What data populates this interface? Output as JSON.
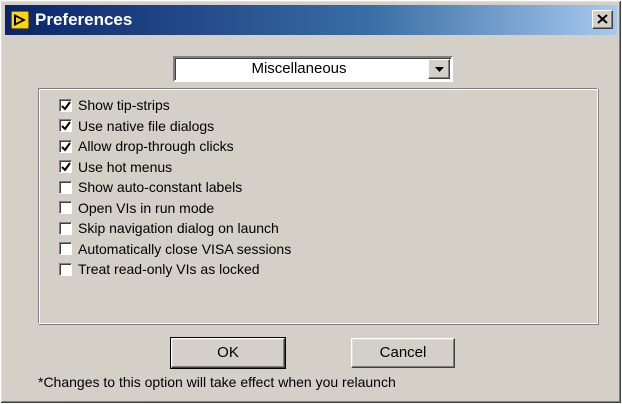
{
  "window": {
    "title": "Preferences",
    "app_icon": "labview-arrow-icon",
    "close_icon": "close-x-icon"
  },
  "category": {
    "selected": "Miscellaneous",
    "arrow_icon": "chevron-down-icon"
  },
  "options": [
    {
      "label": "Show tip-strips",
      "checked": true
    },
    {
      "label": "Use native file dialogs",
      "checked": true
    },
    {
      "label": "Allow drop-through clicks",
      "checked": true
    },
    {
      "label": "Use hot menus",
      "checked": true
    },
    {
      "label": "Show auto-constant labels",
      "checked": false
    },
    {
      "label": "Open VIs in run mode",
      "checked": false
    },
    {
      "label": "Skip navigation dialog on launch",
      "checked": false
    },
    {
      "label": "Automatically close VISA sessions",
      "checked": false
    },
    {
      "label": "Treat read-only VIs as locked",
      "checked": false
    }
  ],
  "buttons": {
    "ok_label": "OK",
    "cancel_label": "Cancel"
  },
  "footnote": "*Changes to this option will take effect when you relaunch",
  "colors": {
    "title_bar": "#0a246a",
    "face": "#d4d0c8"
  }
}
